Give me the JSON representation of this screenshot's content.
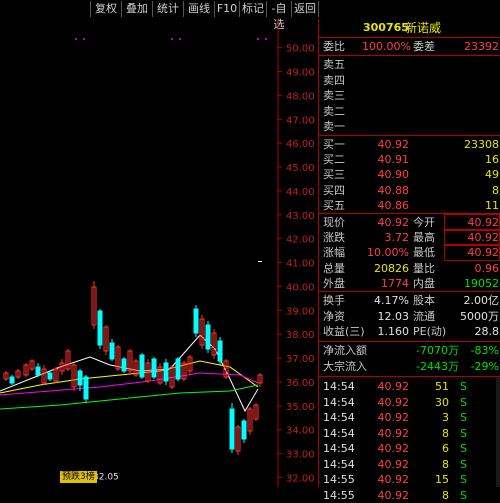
{
  "toolbar": {
    "items": [
      "复权",
      "叠加",
      "统计",
      "画线",
      "F10",
      "标记",
      "-自选",
      "返回"
    ]
  },
  "stock": {
    "code": "300765",
    "name": "新诺威"
  },
  "chart_data": {
    "type": "candlestick",
    "yaxis_ticks": [
      "50.00",
      "49.00",
      "48.00",
      "47.00",
      "46.00",
      "45.00",
      "44.00",
      "43.00",
      "42.00",
      "41.00",
      "40.00",
      "39.00",
      "38.00",
      "37.00",
      "36.00",
      "35.00",
      "34.00",
      "33.00",
      "32.00"
    ],
    "ylim": [
      31.6,
      51.2
    ],
    "low_marker": "32.05",
    "low_marker_value": 32.05,
    "tag": "预跌3榜"
  },
  "colors": {
    "up": "#ff3030",
    "down": "#00ffff",
    "ma5": "#ffffff",
    "ma10": "#ffff00",
    "ma20": "#ff00ff",
    "ma60": "#00ff00",
    "grid": "#b00000"
  },
  "summary": {
    "webi_label": "委比",
    "webi_value": "100.00%",
    "weicha_label": "委差",
    "weicha_value": "23392"
  },
  "sell": [
    {
      "label": "卖五"
    },
    {
      "label": "卖四"
    },
    {
      "label": "卖三"
    },
    {
      "label": "卖二"
    },
    {
      "label": "卖一"
    }
  ],
  "buy": [
    {
      "label": "买一",
      "price": "40.92",
      "volume": "23308"
    },
    {
      "label": "买二",
      "price": "40.91",
      "volume": "16"
    },
    {
      "label": "买三",
      "price": "40.90",
      "volume": "49"
    },
    {
      "label": "买四",
      "price": "40.88",
      "volume": "8"
    },
    {
      "label": "买五",
      "price": "40.86",
      "volume": "11"
    }
  ],
  "quote": [
    {
      "l1": "现价",
      "v1": "40.92",
      "l2": "今开",
      "v2": "40.92"
    },
    {
      "l1": "涨跌",
      "v1": "3.72",
      "l2": "最高",
      "v2": "40.92"
    },
    {
      "l1": "涨幅",
      "v1": "10.00%",
      "l2": "最低",
      "v2": "40.92"
    },
    {
      "l1": "总量",
      "v1": "20826",
      "l2": "量比",
      "v2": "0.96"
    },
    {
      "l1": "外盘",
      "v1": "1774",
      "l2": "内盘",
      "v2": "19052"
    }
  ],
  "fund": [
    {
      "l1": "换手",
      "v1": "4.17%",
      "l2": "股本",
      "v2": "2.00亿"
    },
    {
      "l1": "净资",
      "v1": "12.03",
      "l2": "流通",
      "v2": "5000万"
    },
    {
      "l1": "收益(三)",
      "v1": "1.160",
      "l2": "PE(动)",
      "v2": "28.8"
    }
  ],
  "flow": [
    {
      "label": "净流入额",
      "value": "-7070万",
      "pct": "-83%"
    },
    {
      "label": "大宗流入",
      "value": "-2443万",
      "pct": "-29%"
    }
  ],
  "ticks": [
    {
      "time": "14:54",
      "price": "40.92",
      "vol": "51",
      "side": "S",
      "flag": ""
    },
    {
      "time": "14:54",
      "price": "40.92",
      "vol": "30",
      "side": "S",
      "flag": ""
    },
    {
      "time": "14:54",
      "price": "40.92",
      "vol": "3",
      "side": "S",
      "flag": ""
    },
    {
      "time": "14:54",
      "price": "40.92",
      "vol": "8",
      "side": "S",
      "flag": ""
    },
    {
      "time": "14:54",
      "price": "40.92",
      "vol": "6",
      "side": "S",
      "flag": ""
    },
    {
      "time": "14:54",
      "price": "40.92",
      "vol": "8",
      "side": "S",
      "flag": ""
    },
    {
      "time": "14:55",
      "price": "40.92",
      "vol": "15",
      "side": "S",
      "flag": ""
    },
    {
      "time": "14:55",
      "price": "40.92",
      "vol": "8",
      "side": "S",
      "flag": ""
    }
  ]
}
